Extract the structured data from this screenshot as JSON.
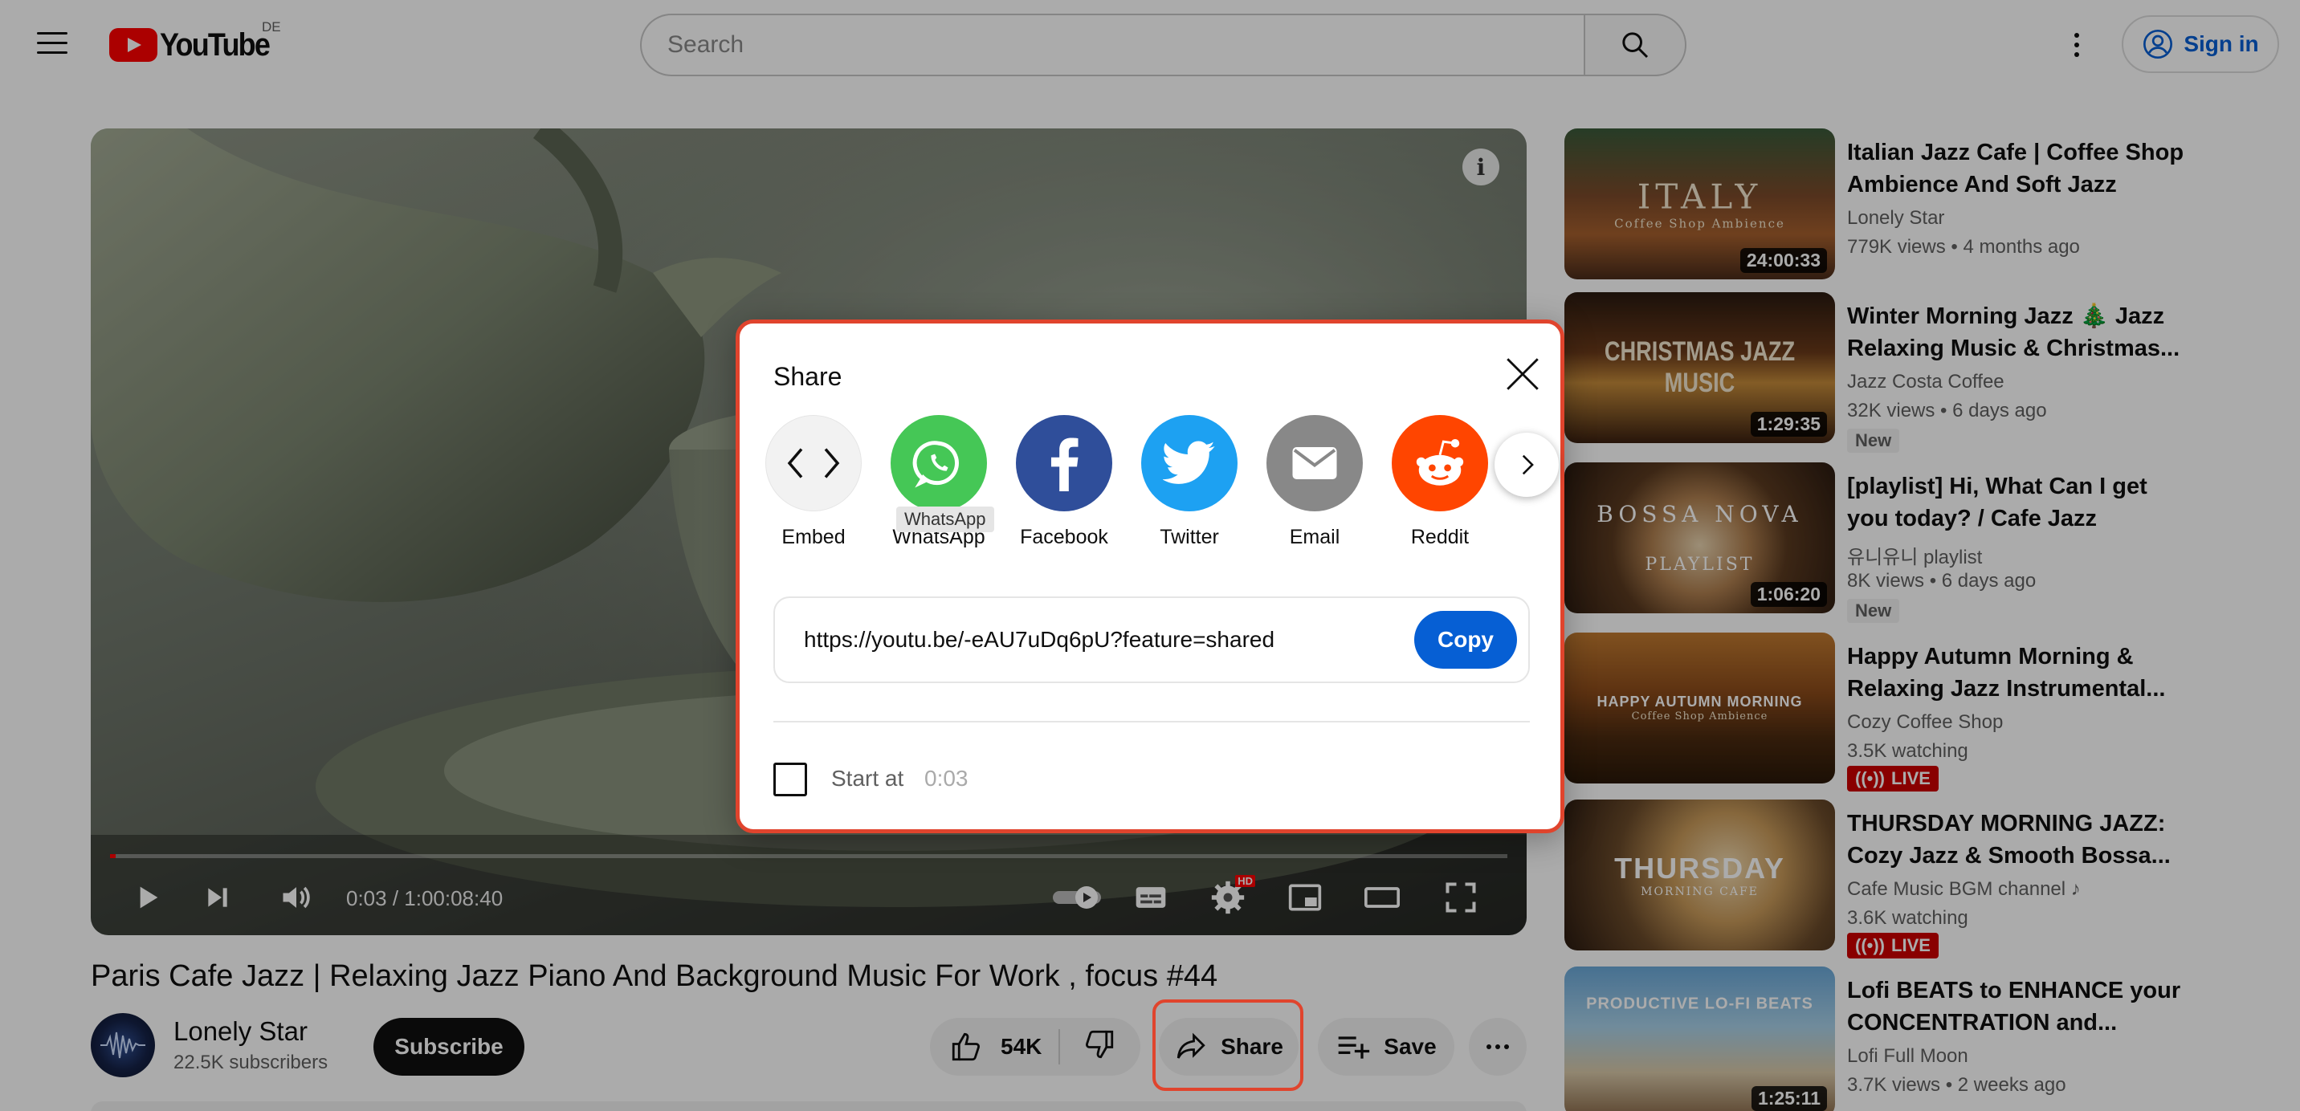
{
  "masthead": {
    "logo_text": "YouTube",
    "region": "DE",
    "search_placeholder": "Search",
    "signin_label": "Sign in"
  },
  "player": {
    "timecode": "0:03 / 1:00:08:40",
    "progress_fraction": 0.0008,
    "hd_badge": "HD"
  },
  "video": {
    "title": "Paris Cafe Jazz | Relaxing Jazz Piano And Background Music For Work , focus #44",
    "channel": "Lonely Star",
    "subscribers": "22.5K subscribers",
    "subscribe_label": "Subscribe",
    "likes": "54K",
    "share_label": "Share",
    "save_label": "Save"
  },
  "share_dialog": {
    "title": "Share",
    "options": [
      {
        "label": "Embed",
        "icon": "embed-icon",
        "color": "#f2f2f2"
      },
      {
        "label": "WhatsApp",
        "icon": "whatsapp-icon",
        "color": "#45c756"
      },
      {
        "label": "Facebook",
        "icon": "facebook-icon",
        "color": "#2f4e9a"
      },
      {
        "label": "Twitter",
        "icon": "twitter-icon",
        "color": "#1da1f2"
      },
      {
        "label": "Email",
        "icon": "email-icon",
        "color": "#888888"
      },
      {
        "label": "Reddit",
        "icon": "reddit-icon",
        "color": "#ff4500"
      }
    ],
    "tooltip": "WhatsApp",
    "url": "https://youtu.be/-eAU7uDq6pU?feature=shared",
    "copy_label": "Copy",
    "start_at_label": "Start at",
    "start_at_value": "0:03"
  },
  "recommendations": [
    {
      "title": "Italian Jazz Cafe | Coffee Shop Ambience And Soft Jazz Musi...",
      "channel": "Lonely Star",
      "stats": "779K views • 4 months ago",
      "duration": "24:00:33",
      "thumb_text": "ITALY",
      "thumb_sub": "Coffee Shop Ambience",
      "badge": ""
    },
    {
      "title": "Winter Morning Jazz 🎄 Jazz Relaxing Music & Christmas...",
      "channel": "Jazz Costa Coffee",
      "stats": "32K views • 6 days ago",
      "duration": "1:29:35",
      "thumb_text": "CHRISTMAS JAZZ MUSIC",
      "thumb_sub": "",
      "badge": "New"
    },
    {
      "title": "[playlist] Hi, What Can I get you today? / Cafe Jazz",
      "channel": "유니유니 playlist",
      "stats": "8K views • 6 days ago",
      "duration": "1:06:20",
      "thumb_text": "BOSSA NOVA",
      "thumb_sub": "PLAYLIST",
      "badge": "New"
    },
    {
      "title": "Happy Autumn Morning & Relaxing Jazz Instrumental...",
      "channel": "Cozy Coffee Shop",
      "stats": "3.5K watching",
      "duration": "",
      "thumb_text": "HAPPY AUTUMN MORNING",
      "thumb_sub": "Coffee Shop Ambience",
      "badge": "LIVE"
    },
    {
      "title": "THURSDAY MORNING JAZZ: Cozy Jazz & Smooth Bossa...",
      "channel": "Cafe Music BGM channel",
      "stats": "3.6K watching",
      "duration": "",
      "thumb_text": "THURSDAY",
      "thumb_sub": "MORNING CAFE",
      "badge": "LIVE"
    },
    {
      "title": "Lofi BEATS to ENHANCE your CONCENTRATION and...",
      "channel": "Lofi Full Moon",
      "stats": "3.7K views • 2 weeks ago",
      "duration": "1:25:11",
      "thumb_text": "PRODUCTIVE LO-FI BEATS",
      "thumb_sub": "",
      "badge": ""
    }
  ],
  "colors": {
    "accent_red": "#ff0000",
    "link_blue": "#065fd4",
    "highlight_outline": "#e0442d"
  }
}
